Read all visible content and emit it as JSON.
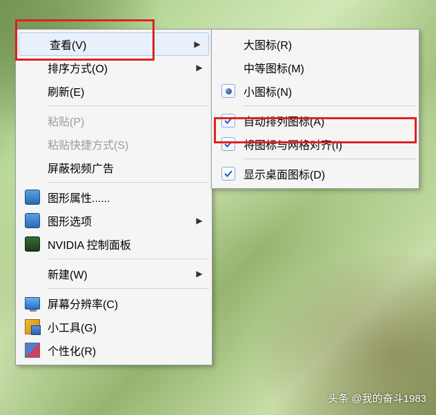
{
  "primary_menu": {
    "view": "查看(V)",
    "sort": "排序方式(O)",
    "refresh": "刷新(E)",
    "paste": "粘贴(P)",
    "paste_shortcut": "粘贴快捷方式(S)",
    "block_video_ads": "屏蔽视频广告",
    "graphics_props": "图形属性......",
    "graphics_options": "图形选项",
    "nvidia": "NVIDIA 控制面板",
    "new": "新建(W)",
    "resolution": "屏幕分辨率(C)",
    "gadgets": "小工具(G)",
    "personalize": "个性化(R)"
  },
  "sub_menu": {
    "large_icons": "大图标(R)",
    "medium_icons": "中等图标(M)",
    "small_icons": "小图标(N)",
    "auto_arrange": "自动排列图标(A)",
    "align_grid": "将图标与网格对齐(I)",
    "show_desktop_icons": "显示桌面图标(D)"
  },
  "watermark": "头条 @我的奋斗1983"
}
